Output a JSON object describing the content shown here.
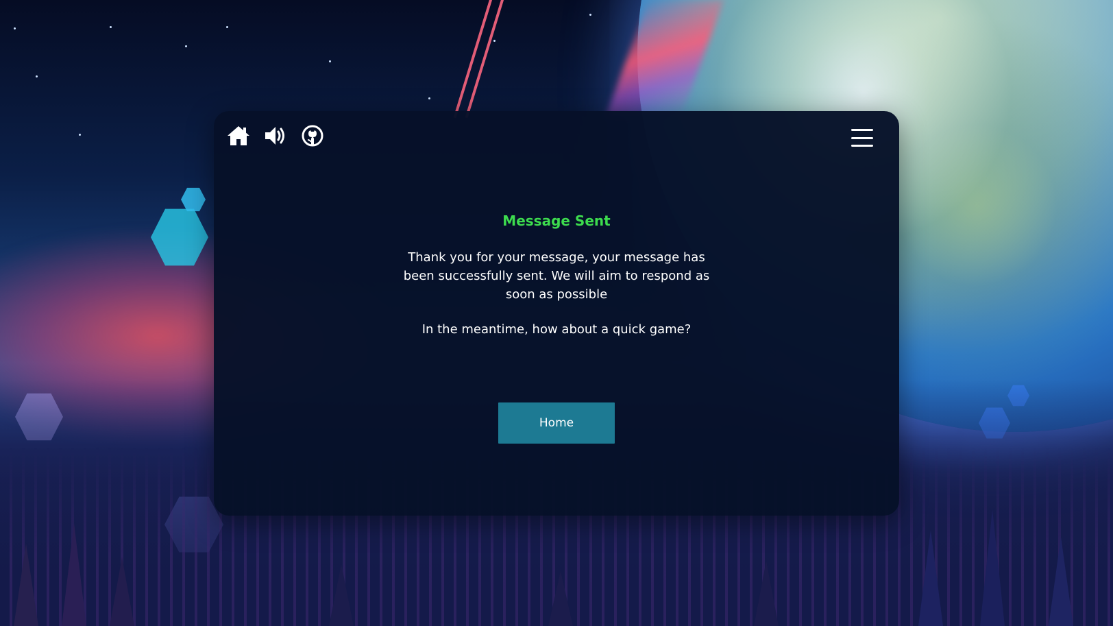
{
  "toolbar": {
    "icons": [
      "home-icon",
      "volume-icon",
      "github-icon"
    ]
  },
  "menu": {
    "icon": "hamburger-menu-icon"
  },
  "message": {
    "title": "Message Sent",
    "body": "Thank you for your message, your message has been successfully sent. We will aim to respond as soon as possible",
    "question": "In the meantime, how about a quick game?"
  },
  "home_button": {
    "label": "Home"
  },
  "colors": {
    "title_green": "#3ddc4e",
    "button_teal": "#1d7a93",
    "panel_bg": "#061128",
    "text": "#ffffff"
  }
}
